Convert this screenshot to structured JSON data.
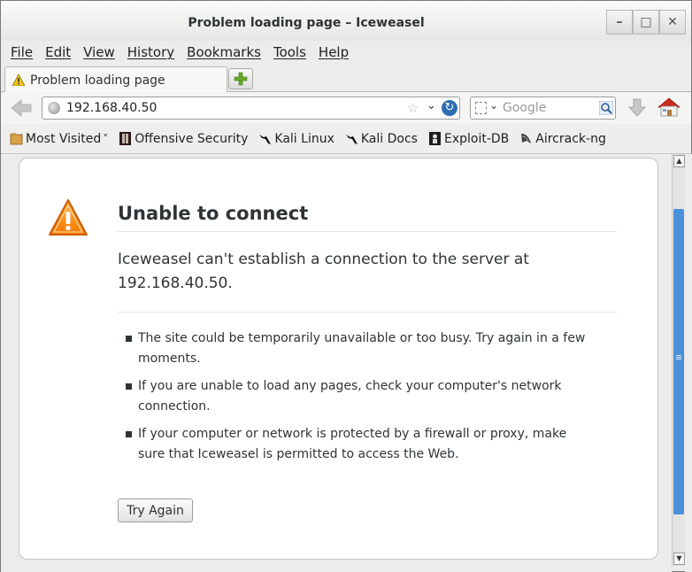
{
  "window": {
    "title": "Problem loading page – Iceweasel",
    "minimize": "–",
    "maximize": "□",
    "close": "✕"
  },
  "menu": [
    "File",
    "Edit",
    "View",
    "History",
    "Bookmarks",
    "Tools",
    "Help"
  ],
  "tab": {
    "label": "Problem loading page",
    "new_tab_symbol": "+"
  },
  "nav": {
    "url": "192.168.40.50",
    "search_placeholder": "Google",
    "star": "☆",
    "dropdown": "⌄",
    "reload": "↻"
  },
  "bookmarks": [
    {
      "label": "Most Visited",
      "icon": "folder-icon",
      "arrow": "˅"
    },
    {
      "label": "Offensive Security",
      "icon": "offsec-icon"
    },
    {
      "label": "Kali Linux",
      "icon": "kali-dragon-icon"
    },
    {
      "label": "Kali Docs",
      "icon": "kali-dragon-icon"
    },
    {
      "label": "Exploit-DB",
      "icon": "exploitdb-icon"
    },
    {
      "label": "Aircrack-ng",
      "icon": "antenna-icon"
    }
  ],
  "error": {
    "title": "Unable to connect",
    "description": "Iceweasel can't establish a connection to the server at 192.168.40.50.",
    "items": [
      "The site could be temporarily unavailable or too busy. Try again in a few moments.",
      "If you are unable to load any pages, check your computer's network connection.",
      "If your computer or network is protected by a firewall or proxy, make sure that Iceweasel is permitted to access the Web."
    ],
    "button": "Try Again"
  },
  "scrollbar": {
    "up": "▲",
    "down": "▼"
  },
  "colors": {
    "accent": "#4a90d9",
    "warning": "#f57900"
  }
}
